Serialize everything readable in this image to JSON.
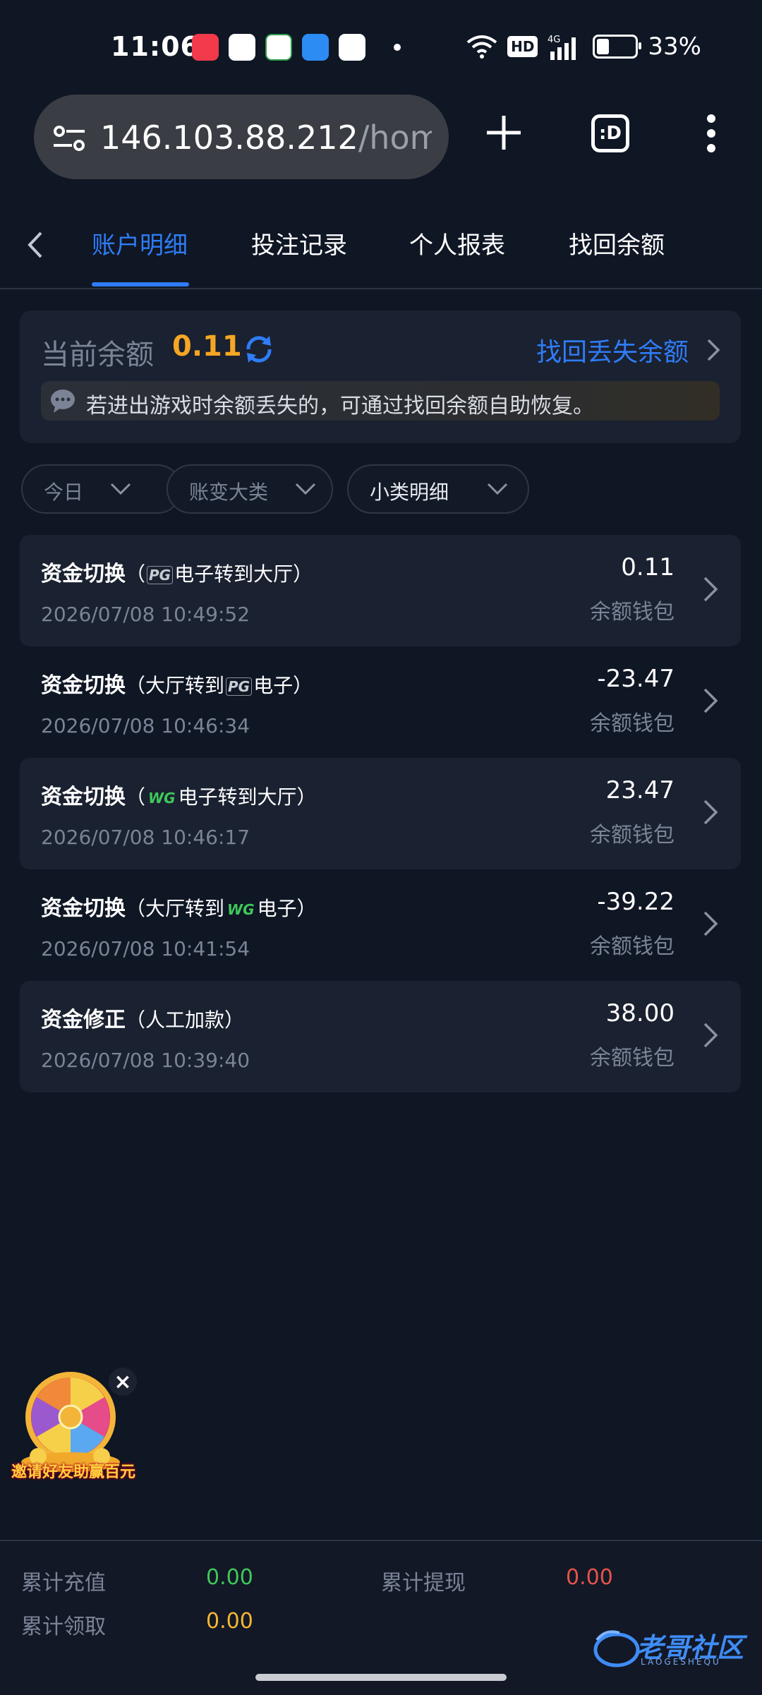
{
  "status_bar": {
    "time": "11:06",
    "network": "4G",
    "hd": "HD",
    "battery_percent_text": "33%",
    "battery_level": 0.33
  },
  "browser": {
    "url_host": "146.103.88.212",
    "url_path": "/home/r",
    "tab_count_label": ":D"
  },
  "nav": {
    "tabs": [
      {
        "label": "账户明细",
        "active": true
      },
      {
        "label": "投注记录",
        "active": false
      },
      {
        "label": "个人报表",
        "active": false
      },
      {
        "label": "找回余额",
        "active": false
      }
    ]
  },
  "balance": {
    "label": "当前余额",
    "value": "0.11",
    "recover_link": "找回丢失余额",
    "hint": "若进出游戏时余额丢失的，可通过找回余额自助恢复。"
  },
  "filters": [
    {
      "label": "今日"
    },
    {
      "label": "账变大类"
    },
    {
      "label": "小类明细"
    }
  ],
  "records": [
    {
      "title": "资金切换",
      "sub_pre": "（",
      "sub_logo": "PG",
      "sub_post": "电子转到大厅）",
      "time": "2026/07/08 10:49:52",
      "amount": "0.11",
      "wallet": "余额钱包"
    },
    {
      "title": "资金切换",
      "sub_pre": "（大厅转到",
      "sub_logo": "PG",
      "sub_post": "电子）",
      "time": "2026/07/08 10:46:34",
      "amount": "-23.47",
      "wallet": "余额钱包"
    },
    {
      "title": "资金切换",
      "sub_pre": "（",
      "sub_logo": "WG",
      "sub_post": "电子转到大厅）",
      "time": "2026/07/08 10:46:17",
      "amount": "23.47",
      "wallet": "余额钱包"
    },
    {
      "title": "资金切换",
      "sub_pre": "（大厅转到",
      "sub_logo": "WG",
      "sub_post": "电子）",
      "time": "2026/07/08 10:41:54",
      "amount": "-39.22",
      "wallet": "余额钱包"
    },
    {
      "title": "资金修正",
      "sub_pre": "（人工加款）",
      "sub_logo": "",
      "sub_post": "",
      "time": "2026/07/08 10:39:40",
      "amount": "38.00",
      "wallet": "余额钱包"
    }
  ],
  "promo": {
    "text": "邀请好友助赢百元"
  },
  "summary": {
    "recharge_label": "累计充值",
    "recharge_value": "0.00",
    "withdraw_label": "累计提现",
    "withdraw_value": "0.00",
    "claimed_label": "累计领取",
    "claimed_value": "0.00"
  },
  "watermark": {
    "text": "老哥社区",
    "sub": "LAOGESHEQU"
  },
  "colors": {
    "accent_blue": "#2f7cf6",
    "balance_orange": "#f5a623",
    "positive_green": "#3fc85a",
    "negative_red": "#e5534b",
    "claimed_yellow": "#f5b731"
  }
}
